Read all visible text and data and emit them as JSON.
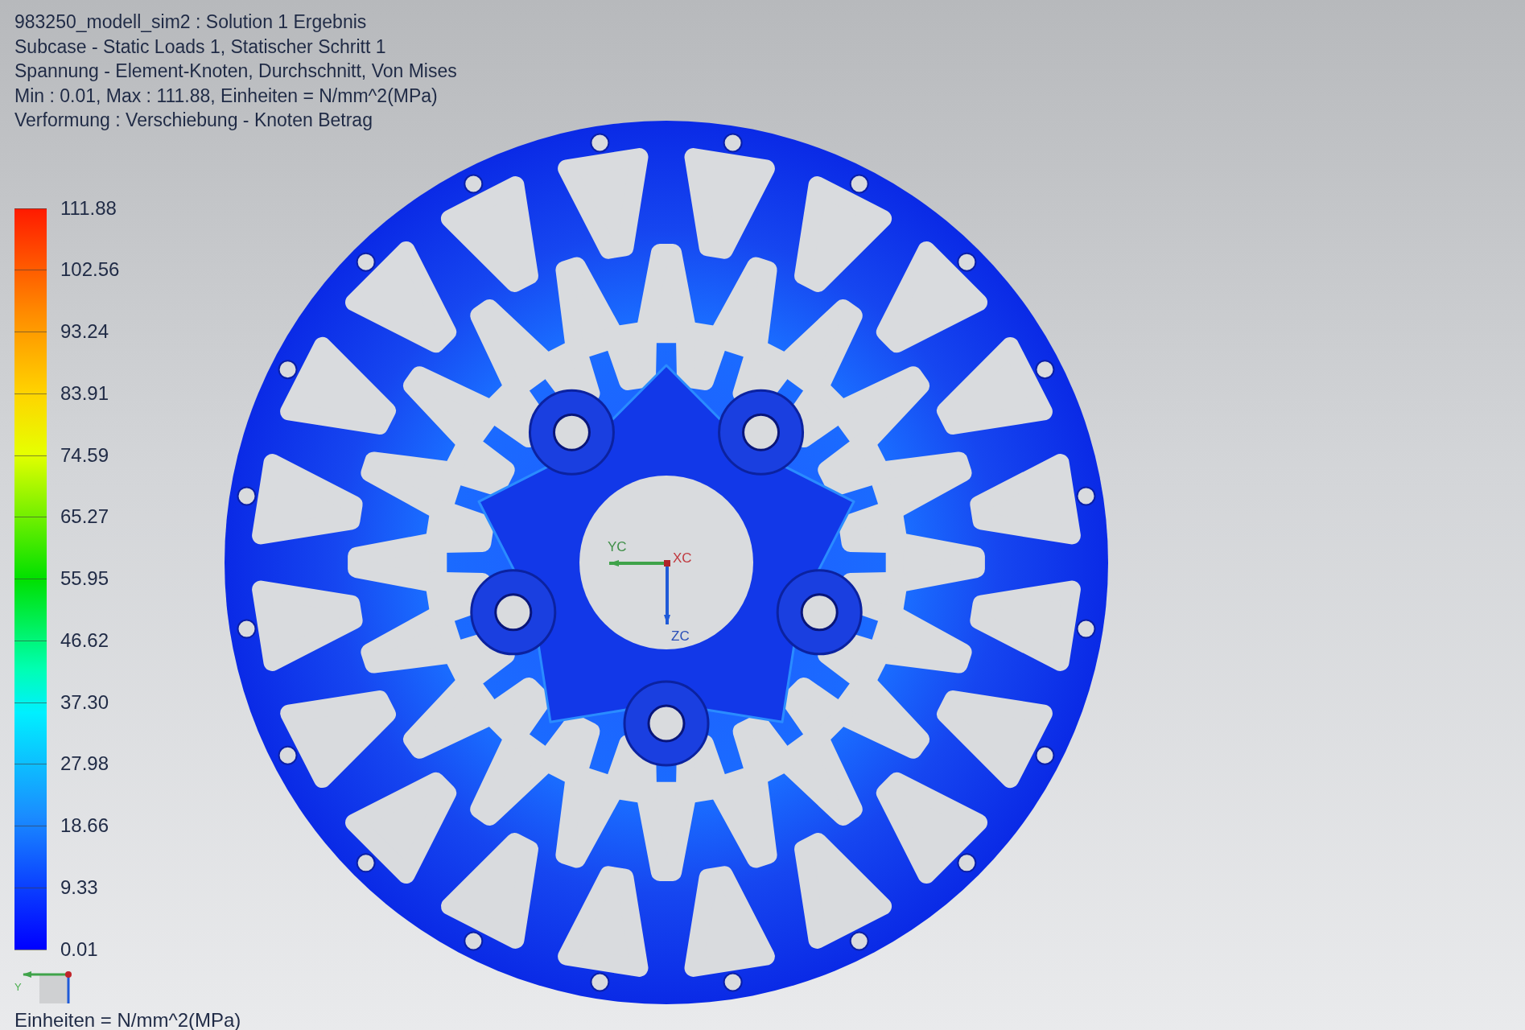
{
  "title_lines": [
    "983250_modell_sim2 : Solution 1 Ergebnis",
    "Subcase - Static Loads 1, Statischer Schritt 1",
    "Spannung - Element-Knoten, Durchschnitt, Von Mises",
    "Min : 0.01, Max : 111.88, Einheiten = N/mm^2(MPa)",
    "Verformung : Verschiebung - Knoten Betrag"
  ],
  "legend": {
    "labels": [
      "111.88",
      "102.56",
      "93.24",
      "83.91",
      "74.59",
      "65.27",
      "55.95",
      "46.62",
      "37.30",
      "27.98",
      "18.66",
      "9.33",
      "0.01"
    ]
  },
  "view_triad": {
    "y_label": "Y"
  },
  "units_label": "Einheiten = N/mm^2(MPa)",
  "model_triad": {
    "y_label": "YC",
    "x_label": "XC",
    "z_label": "ZC"
  }
}
